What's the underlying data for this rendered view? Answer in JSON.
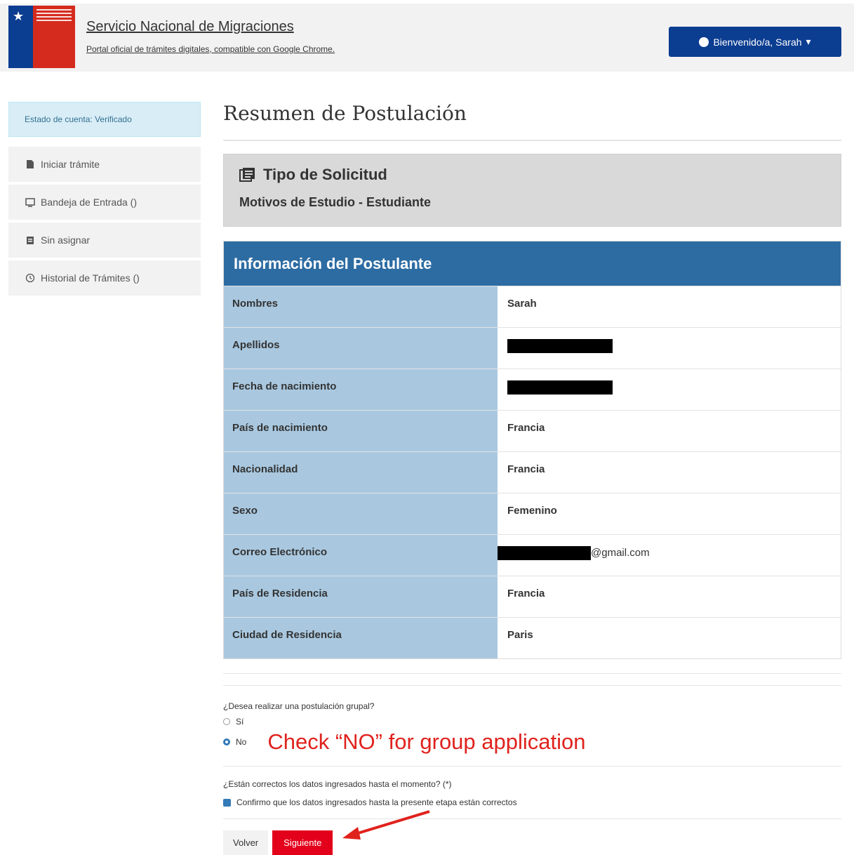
{
  "header": {
    "title": "Servicio Nacional de Migraciones",
    "subtitle": "Portal oficial de trámites digitales, compatible con Google Chrome.",
    "user_button": "Bienvenido/a, Sarah"
  },
  "sidebar": {
    "status": "Estado de cuenta: Verificado",
    "items": [
      {
        "label": "Iniciar trámite",
        "icon": "file-icon"
      },
      {
        "label": "Bandeja de Entrada ()",
        "icon": "inbox-icon"
      },
      {
        "label": "Sin asignar",
        "icon": "clipboard-icon"
      },
      {
        "label": "Historial de Trámites ()",
        "icon": "history-icon"
      }
    ]
  },
  "main": {
    "page_title": "Resumen de Postulación",
    "tipo_heading": "Tipo de Solicitud",
    "tipo_value": "Motivos de Estudio - Estudiante",
    "info_heading": "Información del Postulante",
    "rows": [
      {
        "key": "Nombres",
        "value": "Sarah"
      },
      {
        "key": "Apellidos",
        "value": ""
      },
      {
        "key": "Fecha de nacimiento",
        "value": ""
      },
      {
        "key": "País de nacimiento",
        "value": "Francia"
      },
      {
        "key": "Nacionalidad",
        "value": "Francia"
      },
      {
        "key": "Sexo",
        "value": "Femenino"
      },
      {
        "key": "Correo Electrónico",
        "value": "@gmail.com"
      },
      {
        "key": "País de Residencia",
        "value": "Francia"
      },
      {
        "key": "Ciudad de Residencia",
        "value": "Paris"
      }
    ],
    "group_question": "¿Desea realizar una postulación grupal?",
    "opt_yes": "Sí",
    "opt_no": "No",
    "annotation": "Check “NO” for group application",
    "confirm_question": "¿Están correctos los datos ingresados hasta el momento? (*)",
    "confirm_label": "Confirmo que los datos ingresados hasta la presente etapa están correctos",
    "back_button": "Volver",
    "next_button": "Siguiente"
  }
}
